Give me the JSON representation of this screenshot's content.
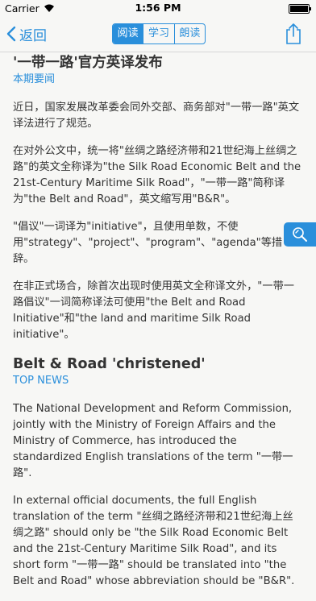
{
  "status": {
    "carrier": "Carrier",
    "time": "1:56 PM"
  },
  "nav": {
    "back_label": "返回",
    "tabs": [
      {
        "label": "阅读",
        "active": true
      },
      {
        "label": "学习",
        "active": false
      },
      {
        "label": "朗读",
        "active": false
      }
    ]
  },
  "article_zh": {
    "title": "'一带一路'官方英译发布",
    "section": "本期要闻",
    "paragraphs": [
      "近日，国家发展改革委会同外交部、商务部对\"一带一路\"英文译法进行了规范。",
      "在对外公文中，统一将\"丝绸之路经济带和21世纪海上丝绸之路\"的英文全称译为\"the Silk Road Economic Belt and the 21st-Century Maritime Silk Road\"，\"一带一路\"简称译为\"the Belt and Road\"，英文缩写用\"B&R\"。",
      "\"倡议\"一词译为\"initiative\"，且使用单数，不使用\"strategy\"、\"project\"、\"program\"、\"agenda\"等措辞。",
      "在非正式场合，除首次出现时使用英文全称译文外，\"一带一路倡议\"一词简称译法可使用\"the Belt and Road Initiative\"和\"the land and maritime Silk Road initiative\"。"
    ]
  },
  "article_en": {
    "title": "Belt & Road 'christened'",
    "section": "TOP NEWS",
    "paragraphs": [
      "The National Development and Reform Commission, jointly with the Ministry of Foreign Affairs and the Ministry of Commerce, has introduced the standardized English translations of the term \"一带一路\".",
      "In external official documents, the full English translation of the term \"丝绸之路经济带和21世纪海上丝绸之路\" should only be \"the Silk Road Economic Belt and the 21st-Century Maritime Silk Road\", and its short form \"一带一路\" should be translated into \"the Belt and Road\" whose abbreviation should be \"B&R\"."
    ]
  },
  "colors": {
    "accent": "#2a8fdb",
    "background": "#f7f7f5"
  }
}
